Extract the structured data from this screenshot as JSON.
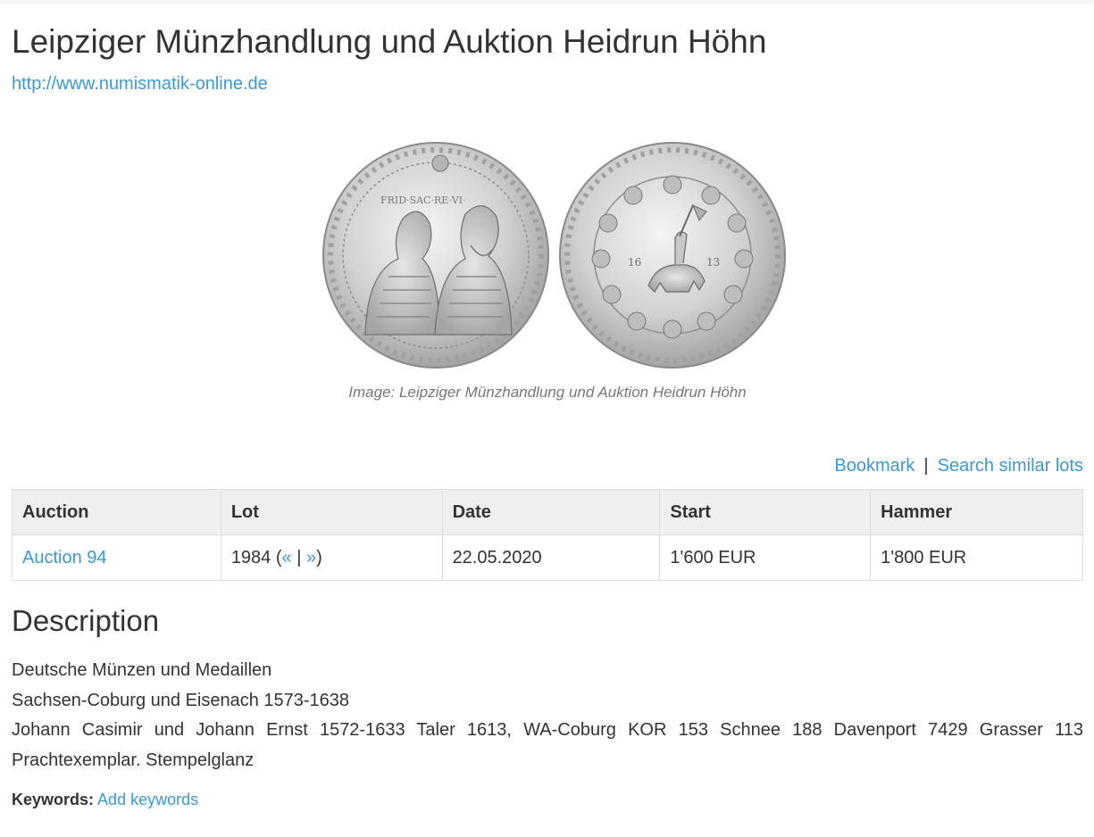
{
  "header": {
    "title": "Leipziger Münzhandlung und Auktion Heidrun Höhn",
    "website": "http://www.numismatik-online.de"
  },
  "image": {
    "caption": "Image: Leipziger Münzhandlung und Auktion Heidrun Höhn",
    "obverse_legend": "FRID·SAC·RE·VI·",
    "reverse_year_left": "16",
    "reverse_year_right": "13"
  },
  "actions": {
    "bookmark": "Bookmark",
    "separator": "|",
    "search_similar": "Search similar lots"
  },
  "lot_table": {
    "headers": [
      "Auction",
      "Lot",
      "Date",
      "Start",
      "Hammer"
    ],
    "row": {
      "auction": "Auction 94",
      "lot_number": "1984 (",
      "prev": "«",
      "nav_sep": " | ",
      "next": "»",
      "lot_close": ")",
      "date": "22.05.2020",
      "start": "1'600 EUR",
      "hammer": "1'800 EUR"
    }
  },
  "description": {
    "title": "Description",
    "lines": [
      "Deutsche Münzen und Medaillen",
      "Sachsen-Coburg und Eisenach 1573-1638",
      "Johann Casimir und Johann Ernst 1572-1633 Taler 1613, WA-Coburg KOR 153 Schnee 188 Davenport 7429 Grasser 113",
      "Prachtexemplar. Stempelglanz"
    ]
  },
  "keywords": {
    "label": "Keywords:",
    "add_link": "Add keywords"
  },
  "colors": {
    "link": "#3a9ad1",
    "text": "#333333",
    "table_header_bg": "#efefef",
    "caption": "#777777",
    "silver": "#c9c9c9"
  }
}
